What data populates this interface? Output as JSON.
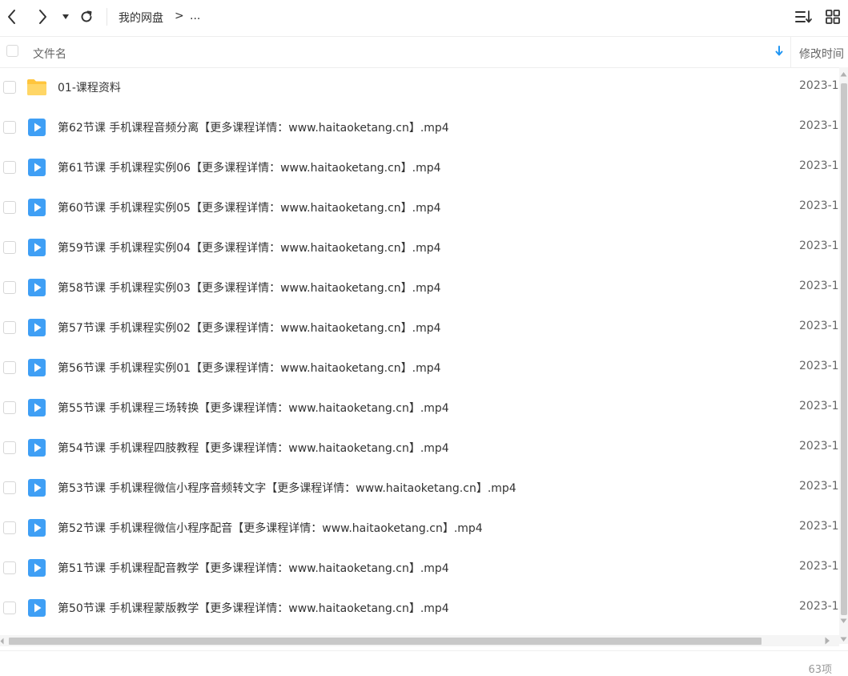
{
  "toolbar": {
    "icons": [
      "back-icon",
      "forward-icon",
      "history-dropdown-icon",
      "refresh-icon",
      "sort-list-icon",
      "grid-view-icon"
    ]
  },
  "breadcrumb": {
    "root": "我的网盘",
    "separator": ">",
    "more": "..."
  },
  "columns": {
    "name": "文件名",
    "modified": "修改时间"
  },
  "files": [
    {
      "type": "folder",
      "name": "01-课程资料",
      "time": "2023-1"
    },
    {
      "type": "video",
      "name": "第62节课 手机课程音频分离【更多课程详情：www.haitaoketang.cn】.mp4",
      "time": "2023-1"
    },
    {
      "type": "video",
      "name": "第61节课 手机课程实例06【更多课程详情：www.haitaoketang.cn】.mp4",
      "time": "2023-1"
    },
    {
      "type": "video",
      "name": "第60节课 手机课程实例05【更多课程详情：www.haitaoketang.cn】.mp4",
      "time": "2023-1"
    },
    {
      "type": "video",
      "name": "第59节课 手机课程实例04【更多课程详情：www.haitaoketang.cn】.mp4",
      "time": "2023-1"
    },
    {
      "type": "video",
      "name": "第58节课 手机课程实例03【更多课程详情：www.haitaoketang.cn】.mp4",
      "time": "2023-1"
    },
    {
      "type": "video",
      "name": "第57节课 手机课程实例02【更多课程详情：www.haitaoketang.cn】.mp4",
      "time": "2023-1"
    },
    {
      "type": "video",
      "name": "第56节课 手机课程实例01【更多课程详情：www.haitaoketang.cn】.mp4",
      "time": "2023-1"
    },
    {
      "type": "video",
      "name": "第55节课 手机课程三场转换【更多课程详情：www.haitaoketang.cn】.mp4",
      "time": "2023-1"
    },
    {
      "type": "video",
      "name": "第54节课 手机课程四肢教程【更多课程详情：www.haitaoketang.cn】.mp4",
      "time": "2023-1"
    },
    {
      "type": "video",
      "name": "第53节课 手机课程微信小程序音频转文字【更多课程详情：www.haitaoketang.cn】.mp4",
      "time": "2023-1"
    },
    {
      "type": "video",
      "name": "第52节课 手机课程微信小程序配音【更多课程详情：www.haitaoketang.cn】.mp4",
      "time": "2023-1"
    },
    {
      "type": "video",
      "name": "第51节课 手机课程配音教学【更多课程详情：www.haitaoketang.cn】.mp4",
      "time": "2023-1"
    },
    {
      "type": "video",
      "name": "第50节课 手机课程蒙版教学【更多课程详情：www.haitaoketang.cn】.mp4",
      "time": "2023-1"
    }
  ],
  "footer": {
    "count": "63项"
  },
  "colors": {
    "accent": "#2196f3",
    "video_icon": "#3f9ff5",
    "folder_icon": "#ffc53d"
  }
}
